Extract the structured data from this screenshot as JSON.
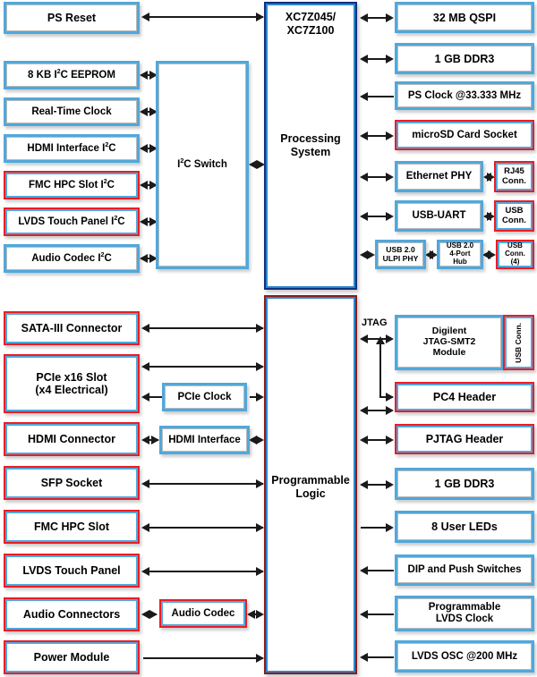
{
  "diagram": {
    "title": "Zynq-7000 XC7Z045/XC7Z100 Board Block Diagram",
    "colors": {
      "peripheral_border": "#4FA8DC",
      "connector_border": "#ED1C24",
      "ps_border": "#12307E",
      "pl_border": "#8E1B1B",
      "line": "#1A1A1A",
      "background": "#FFFFFF"
    }
  },
  "core": {
    "ps": {
      "device": "XC7Z045/\nXC7Z100",
      "device_line1": "XC7Z045/",
      "device_line2": "XC7Z100",
      "name_line1": "Processing",
      "name_line2": "System"
    },
    "pl": {
      "name_line1": "Programmable",
      "name_line2": "Logic"
    }
  },
  "i2c_switch": {
    "label": "I²C Switch"
  },
  "ps_left": [
    {
      "label": "PS Reset",
      "style": "blue",
      "arrow": "both"
    },
    {
      "label": "8 KB I²C EEPROM",
      "style": "blue",
      "arrow": "both"
    },
    {
      "label": "Real-Time Clock",
      "style": "blue",
      "arrow": "both"
    },
    {
      "label": "HDMI Interface I²C",
      "style": "blue",
      "arrow": "both"
    },
    {
      "label": "FMC HPC Slot I²C",
      "style": "red",
      "arrow": "both"
    },
    {
      "label": "LVDS Touch Panel I²C",
      "style": "red",
      "arrow": "both"
    },
    {
      "label": "Audio Codec I²C",
      "style": "blue",
      "arrow": "both"
    }
  ],
  "ps_right": [
    {
      "label": "32 MB QSPI",
      "style": "blue",
      "arrow": "both"
    },
    {
      "label": "1 GB DDR3",
      "style": "blue",
      "arrow": "both"
    },
    {
      "label": "PS Clock @33.333 MHz",
      "style": "blue",
      "arrow": "left"
    },
    {
      "label": "microSD Card Socket",
      "style": "red",
      "arrow": "both"
    },
    {
      "label": "Ethernet PHY",
      "style": "blue",
      "arrow": "both"
    },
    {
      "label": "USB-UART",
      "style": "blue",
      "arrow": "both"
    }
  ],
  "ps_far_right": [
    {
      "label": "RJ45\nConn.",
      "line1": "RJ45",
      "line2": "Conn.",
      "style": "red"
    },
    {
      "label": "USB\nConn.",
      "line1": "USB",
      "line2": "Conn.",
      "style": "red"
    }
  ],
  "usb_chain": [
    {
      "line1": "USB 2.0",
      "line2": "ULPI PHY",
      "style": "blue"
    },
    {
      "line1": "USB 2.0",
      "line2": "4-Port",
      "line3": "Hub",
      "style": "blue"
    },
    {
      "line1": "USB",
      "line2": "Conn.",
      "line3": "(4)",
      "style": "red"
    }
  ],
  "pl_left": [
    {
      "label": "SATA-III Connector",
      "style": "red",
      "arrow": "both"
    },
    {
      "label": "PCIe x16 Slot\n(x4 Electrical)",
      "line1": "PCIe x16 Slot",
      "line2": "(x4 Electrical)",
      "style": "red",
      "arrow": "both"
    },
    {
      "label": "HDMI Connector",
      "style": "red",
      "arrow": "both"
    },
    {
      "label": "SFP Socket",
      "style": "red",
      "arrow": "both"
    },
    {
      "label": "FMC HPC Slot",
      "style": "red",
      "arrow": "both"
    },
    {
      "label": "LVDS Touch Panel",
      "style": "red",
      "arrow": "both"
    },
    {
      "label": "Audio Connectors",
      "style": "red",
      "arrow": "both"
    },
    {
      "label": "Power Module",
      "style": "red",
      "arrow": "right"
    }
  ],
  "pl_mid": [
    {
      "label": "PCIe Clock",
      "style": "blue",
      "arrow": "out"
    },
    {
      "label": "HDMI Interface",
      "style": "blue",
      "arrow": "both"
    },
    {
      "label": "Audio Codec",
      "style": "red",
      "arrow": "both"
    }
  ],
  "pl_right": [
    {
      "label": "Digilent\nJTAG-SMT2\nModule",
      "line1": "Digilent",
      "line2": "JTAG-SMT2",
      "line3": "Module",
      "style": "blue",
      "arrow": "both"
    },
    {
      "label": "PC4 Header",
      "style": "red",
      "arrow": "both"
    },
    {
      "label": "PJTAG Header",
      "style": "red",
      "arrow": "both"
    },
    {
      "label": "1 GB DDR3",
      "style": "blue",
      "arrow": "both"
    },
    {
      "label": "8 User LEDs",
      "style": "blue",
      "arrow": "right"
    },
    {
      "label": "DIP and Push Switches",
      "style": "blue",
      "arrow": "left"
    },
    {
      "label": "Programmable\nLVDS Clock",
      "line1": "Programmable",
      "line2": "LVDS Clock",
      "style": "blue",
      "arrow": "left"
    },
    {
      "label": "LVDS OSC @200 MHz",
      "style": "blue",
      "arrow": "left"
    }
  ],
  "jtag_usb_conn": {
    "line1": "USB",
    "line2": "Conn.",
    "label": "USB Conn.",
    "style": "red"
  },
  "labels": {
    "jtag": "JTAG"
  }
}
